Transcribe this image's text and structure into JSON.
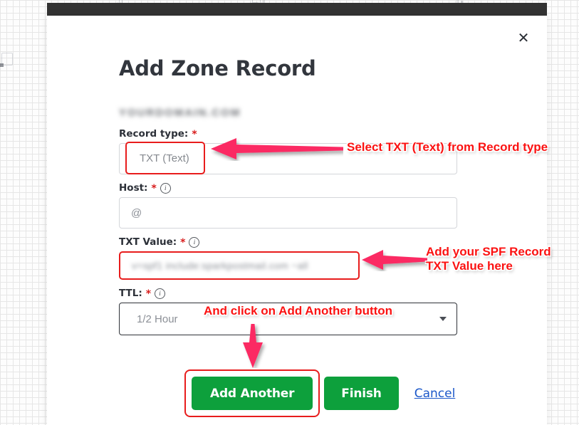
{
  "window": {
    "close_icon": "close-icon"
  },
  "modal": {
    "title": "Add Zone Record",
    "domain_blurred": "YOURDOMAIN.COM",
    "close_label": "✕"
  },
  "form": {
    "fields": [
      {
        "label": "Record type:",
        "required_mark": "*",
        "has_info": false,
        "value": "TXT (Text)",
        "type": "select"
      },
      {
        "label": "Host:",
        "required_mark": "*",
        "has_info": true,
        "info_glyph": "i",
        "value": "@",
        "type": "text"
      },
      {
        "label": "TXT Value:",
        "required_mark": "*",
        "has_info": true,
        "info_glyph": "i",
        "value": "v=spf1 include:sparkpostmail.com ~all",
        "type": "text"
      },
      {
        "label": "TTL:",
        "required_mark": "*",
        "has_info": true,
        "info_glyph": "i",
        "value": "1/2 Hour",
        "type": "select"
      }
    ]
  },
  "footer": {
    "add_another_label": "Add Another",
    "finish_label": "Finish",
    "cancel_label": "Cancel"
  },
  "annotations": [
    {
      "text": "Select TXT (Text) from Record type"
    },
    {
      "text": "Add your SPF Record"
    },
    {
      "text": "TXT Value here"
    },
    {
      "text": "And click on Add Another button"
    }
  ],
  "colors": {
    "annotation_red": "#fb1212",
    "arrow_pink": "#fb2b63",
    "highlight_red": "#e81c1c",
    "button_green": "#0da03c",
    "link_blue": "#1b57c9",
    "required_red": "#d81d1d",
    "top_bar_dark": "#333333"
  },
  "top_strip": {
    "marks": [
      "·|·|",
      "·|—·|·||",
      "||  ≡"
    ]
  }
}
